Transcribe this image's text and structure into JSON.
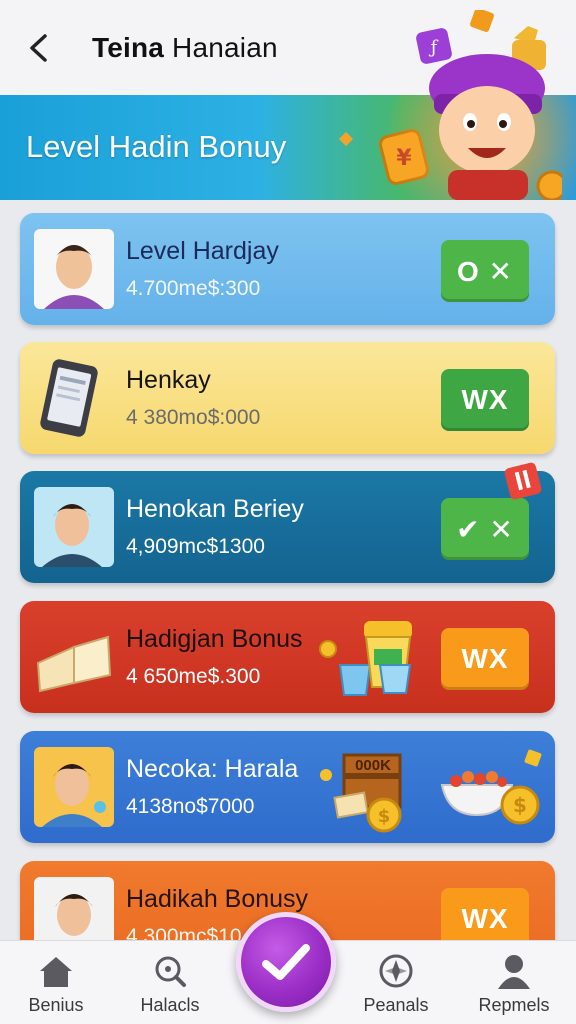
{
  "header": {
    "back_icon": "chevron-left-icon",
    "title_bold": "Teina",
    "title_rest": " Hanaian"
  },
  "banner": {
    "title": "Level Hadin Bonuy"
  },
  "cards": [
    {
      "name": "Level Hardjay",
      "amount": "4.700me$:300",
      "action": "O ✕",
      "thumb": "avatar"
    },
    {
      "name": "Henkay",
      "amount": "4 380mo$:000",
      "action": "WX",
      "thumb": "phone"
    },
    {
      "name": "Henokan Beriey",
      "amount": "4,909mc$1300",
      "action": "✔ ✕",
      "thumb": "avatar"
    },
    {
      "name": "Hadigjan Bonus",
      "amount": "4 650me$.300",
      "action": "WX",
      "thumb": "book"
    },
    {
      "name": "Necoka: Harala",
      "amount": "4138no$7000",
      "action": "",
      "thumb": "avatar"
    },
    {
      "name": "Hadikah Bonusy",
      "amount": "4 300mc$10",
      "action": "WX",
      "thumb": "avatar"
    }
  ],
  "extras": {
    "chest_label": "000K"
  },
  "nav": [
    {
      "label": "Benius",
      "icon": "home-icon"
    },
    {
      "label": "Halacls",
      "icon": "search-icon"
    },
    {
      "label": "Peanals",
      "icon": "compass-icon"
    },
    {
      "label": "Repmels",
      "icon": "person-icon"
    }
  ],
  "fab": {
    "icon": "check-icon"
  },
  "colors": {
    "primary_blue": "#1aa0d8",
    "fab_purple": "#9b2ec6",
    "green_button": "#4eb548",
    "orange_button": "#f99a1b"
  }
}
